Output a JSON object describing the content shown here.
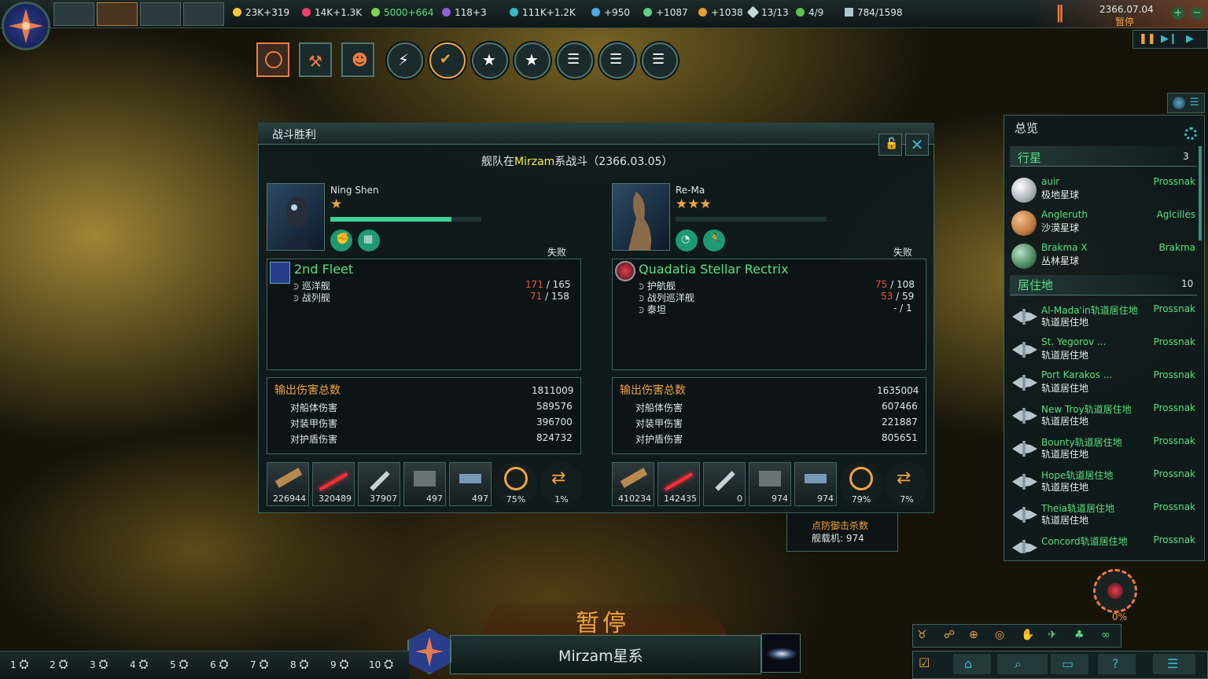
{
  "topbar": {
    "resources": [
      {
        "name": "energy",
        "value": "23K+319",
        "color": "#f3c640"
      },
      {
        "name": "minerals",
        "value": "14K+1.3K",
        "color": "#e94070"
      },
      {
        "name": "food",
        "value": "5000+664",
        "color": "#7fd548",
        "highlight": true
      },
      {
        "name": "influence",
        "value": "118+3",
        "color": "#9060d8"
      },
      {
        "name": "unity",
        "value": "111K+1.2K",
        "color": "#37b8c8"
      },
      {
        "name": "physics",
        "value": "+950",
        "color": "#4aa8e8"
      },
      {
        "name": "society",
        "value": "+1087",
        "color": "#5ed080"
      },
      {
        "name": "engineering",
        "value": "+1038",
        "color": "#e8a030"
      },
      {
        "name": "edicts",
        "value": "13/13",
        "color": "#c8d8d8"
      },
      {
        "name": "planets",
        "value": "4/9",
        "color": "#60c050"
      },
      {
        "name": "fleet",
        "value": "784/1598",
        "color": "#b0c8d0"
      }
    ],
    "date": "2366.07.04",
    "status": "暂停"
  },
  "battle": {
    "title": "战斗胜利",
    "headline_prefix": "舰队在",
    "system": "Mirzam",
    "headline_suffix": "系战斗（2366.03.05）",
    "left": {
      "leader": "Ning Shen",
      "stars": "★",
      "result": "失败",
      "fleet": "2nd Fleet",
      "ships": [
        {
          "type": "巡洋舰",
          "lost": "171",
          "total": " / 165"
        },
        {
          "type": "战列舰",
          "lost": "71",
          "total": " / 158"
        }
      ],
      "damage_title": "输出伤害总数",
      "damage_total": "1811009",
      "damage": [
        {
          "label": "对船体伤害",
          "value": "589576"
        },
        {
          "label": "对装甲伤害",
          "value": "396700"
        },
        {
          "label": "对护盾伤害",
          "value": "824732"
        }
      ],
      "weapons": [
        "226944",
        "320489",
        "37907",
        "497",
        "497"
      ],
      "pct": [
        "75%",
        "1%"
      ]
    },
    "right": {
      "leader": "Re-Ma",
      "stars": "★★★",
      "result": "失败",
      "fleet": "Quadatia Stellar Rectrix",
      "ships": [
        {
          "type": "护航舰",
          "lost": "75",
          "total": " / 108"
        },
        {
          "type": "战列巡洋舰",
          "lost": "53",
          "total": " / 59"
        },
        {
          "type": "泰坦",
          "lost": "",
          "total": "- / 1"
        }
      ],
      "damage_title": "输出伤害总数",
      "damage_total": "1635004",
      "damage": [
        {
          "label": "对船体伤害",
          "value": "607466"
        },
        {
          "label": "对装甲伤害",
          "value": "221887"
        },
        {
          "label": "对护盾伤害",
          "value": "805651"
        }
      ],
      "weapons": [
        "410234",
        "142435",
        "0",
        "974",
        "974"
      ],
      "pct": [
        "79%",
        "7%"
      ]
    },
    "tooltip": {
      "title": "点防御击杀数",
      "line": "舰载机: 974"
    }
  },
  "overview": {
    "title": "总览",
    "planets_header": "行星",
    "planets_count": "3",
    "planets": [
      {
        "name": "auir",
        "type": "极地星球",
        "owner": "Prossnak",
        "color": "#c8ccd0"
      },
      {
        "name": "Angleruth",
        "type": "沙漠星球",
        "owner": "Aglcilles",
        "color": "#c07840"
      },
      {
        "name": "Brakma X",
        "type": "丛林星球",
        "owner": "Brakma",
        "color": "#4a8860"
      }
    ],
    "habitats_header": "居住地",
    "habitats_count": "10",
    "habitats": [
      {
        "name": "Al-Mada'in轨道居住地",
        "type": "轨道居住地",
        "owner": "Prossnak"
      },
      {
        "name": "St. Yegorov ...",
        "type": "轨道居住地",
        "owner": "Prossnak"
      },
      {
        "name": "Port Karakos ...",
        "type": "轨道居住地",
        "owner": "Prossnak"
      },
      {
        "name": "New Troy轨道居住地",
        "type": "轨道居住地",
        "owner": "Prossnak"
      },
      {
        "name": "Bounty轨道居住地",
        "type": "轨道居住地",
        "owner": "Prossnak"
      },
      {
        "name": "Hope轨道居住地",
        "type": "轨道居住地",
        "owner": "Prossnak"
      },
      {
        "name": "Theia轨道居住地",
        "type": "轨道居住地",
        "owner": "Prossnak"
      },
      {
        "name": "Concord轨道居住地",
        "type": "",
        "owner": "Prossnak"
      }
    ]
  },
  "bottom": {
    "paused": "暂停",
    "system_name": "Mirzam星系",
    "groups": [
      "1",
      "2",
      "3",
      "4",
      "5",
      "6",
      "7",
      "8",
      "9",
      "10"
    ],
    "progress": "0%"
  }
}
